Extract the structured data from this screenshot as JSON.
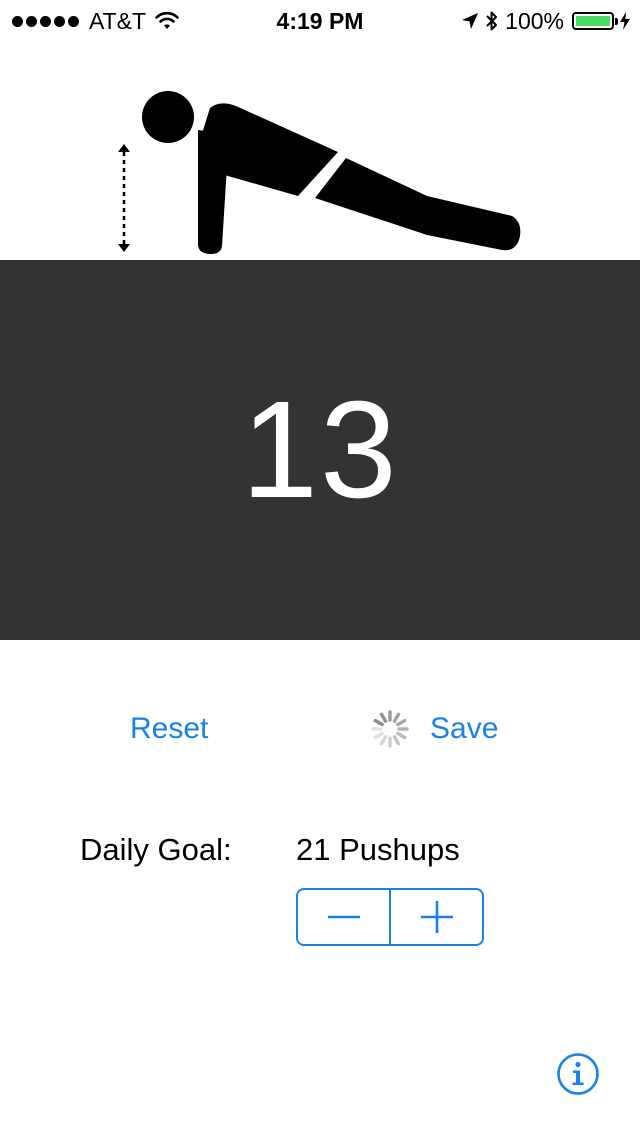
{
  "status_bar": {
    "carrier": "AT&T",
    "time": "4:19 PM",
    "battery_percent": "100%",
    "battery_level": 1.0,
    "signal_bars": 5,
    "icons": [
      "wifi-icon",
      "location-arrow-icon",
      "bluetooth-icon",
      "battery-icon",
      "charging-bolt-icon"
    ]
  },
  "illustration": {
    "icon": "pushup-figure-icon",
    "indicator": "vertical-range-arrow-icon"
  },
  "counter": {
    "value": "13"
  },
  "actions": {
    "reset_label": "Reset",
    "save_label": "Save",
    "loading_indicator": "activity-spinner-icon"
  },
  "goal": {
    "label": "Daily Goal:",
    "value_text": "21 Pushups",
    "decrement_icon": "minus-icon",
    "increment_icon": "plus-icon"
  },
  "info": {
    "icon": "info-icon"
  },
  "colors": {
    "accent": "#1a82e6",
    "counter_background": "#333333",
    "counter_text": "#ffffff",
    "battery": "#4cd964"
  }
}
